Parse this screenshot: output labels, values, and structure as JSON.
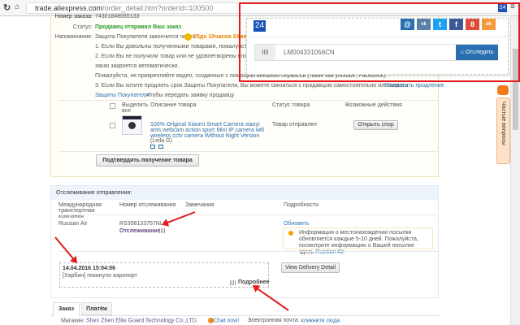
{
  "browser": {
    "url_host": "trade.aliexpress.com",
    "url_path": "/order_detail.htm?orderId=100500",
    "ext_badge": "24"
  },
  "order": {
    "number_label": "Номер заказа:",
    "number_value": "74301848055133",
    "status_label": "Статус:",
    "status_value": "Продавец отправил Ваш заказ",
    "reminder_label": "Напоминание:",
    "reminder_value": "Защита Покупателя закончится через",
    "countdown": "25дн 10часов 24мин 4",
    "lines": [
      "1. Если Вы довольны полученными товарами, пожалуйста, нажми",
      "2. Если Вы не получили товар или не удовлетворены его состояни",
      "заказ закроется автоматически.",
      "Пожалуйста, не прикрепляйте видео, созданные с помощью внешних сервисов (такие как youtube, Facebook).",
      "3. Если Вы хотите продлить срок Защиты Покупателя, Вы можете связаться с продавцом самостоятельно или нажать"
    ],
    "extend_link_a": "\"Запросить продление",
    "extend_link_b": "Защиты Покупателя\"",
    "extend_tail": ", чтобы передать заявку продавцу",
    "table_headers": [
      "Выделить все",
      "Описание товара",
      "Статус товара",
      "Возможные действия"
    ],
    "item": {
      "title": "100% Original Xiaomi Smart Camera xiaoyi ants webcam action sport Mini IP camera wifi wireless cctv camera Without Night Version",
      "variant": "(Leila G)",
      "status": "Товар отправлен",
      "action": "Открыть спор"
    },
    "confirm_button": "Подтвердить получение товара"
  },
  "tracking": {
    "title": "Отслеживание отправления:",
    "headers": [
      "Международная транспортная компания",
      "Номер отслеживания",
      "Замечания",
      "Подробности"
    ],
    "carrier": "Russian Air",
    "number": "RS356133757NL",
    "track_link": "Отслеживание",
    "refresh": "Обновить",
    "info": "Информация о местонахождении посылки обновляется каждые 5-10 дней. Пожалуйста, посмотрите информацию о Вашей посылке здесь",
    "info_link": "Russian Air.",
    "event_time": "14.04.2016 15:04:06",
    "event_text": "[Харбин] покинуло аэропорт",
    "more": "Подробнее",
    "view_detail": "View Delivery Detail"
  },
  "tabs": [
    "Заказ",
    "Платёж"
  ],
  "footer": {
    "shop_label": "Магазин:",
    "shop": "Shen Zhen Elite Guard Technology Co.,LTD.",
    "chat": "Chat now!",
    "email_label": "Электронная почта:",
    "email_link": "кликните сюда"
  },
  "popup": {
    "logo": "24",
    "socials": [
      "@",
      "vk",
      "t",
      "f",
      "8",
      "ok"
    ],
    "tracking_value": "LM004331056CN",
    "track_button": "Отследить"
  },
  "feedback_tab": "Частые вопросы",
  "colors": {
    "accent": "#e21a1a",
    "link": "#2a6fb0",
    "status": "#2a9a2a",
    "countdown": "#e67e00"
  }
}
